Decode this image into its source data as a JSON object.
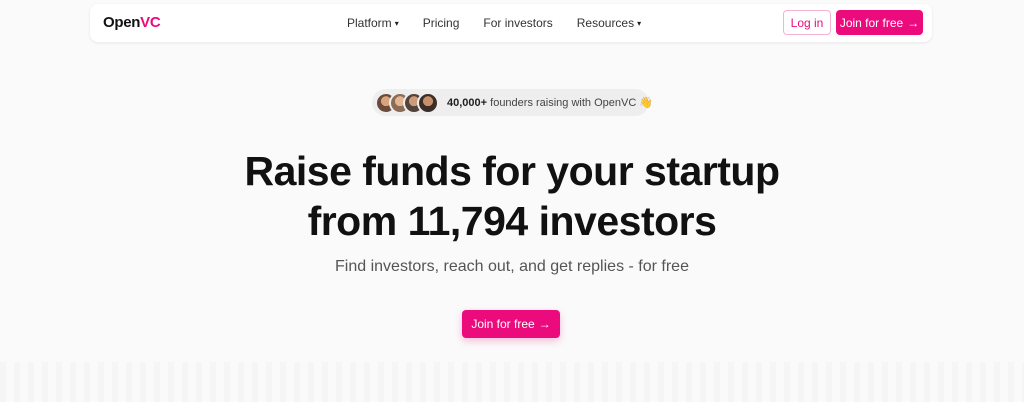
{
  "brand": {
    "logo_main": "Open",
    "logo_accent": "VC",
    "accent_color": "#ec0b7c"
  },
  "nav": {
    "links": [
      {
        "label": "Platform",
        "caret": "▾"
      },
      {
        "label": "Pricing"
      },
      {
        "label": "For investors"
      },
      {
        "label": "Resources",
        "caret": "▾"
      }
    ],
    "login_label": "Log in",
    "join_label": "Join for free",
    "join_arrow": "→"
  },
  "social_proof": {
    "count": "40,000+",
    "text": "founders raising with OpenVC 👋"
  },
  "hero": {
    "headline_line1": "Raise funds for your startup",
    "headline_line2": "from 11,794 investors",
    "subheadline": "Find investors, reach out, and get replies - for free",
    "cta_label": "Join for free",
    "cta_arrow": "→"
  }
}
